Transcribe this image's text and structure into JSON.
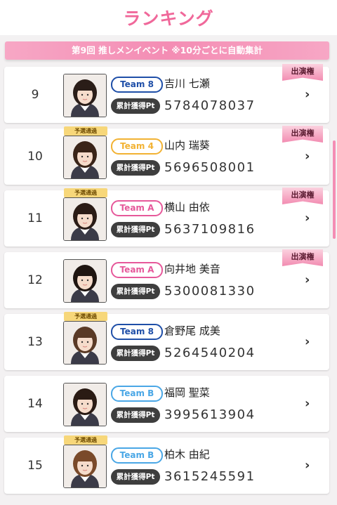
{
  "page": {
    "title": "ランキング"
  },
  "banner": {
    "text": "第9回 推しメンイベント ※10分ごとに自動集計"
  },
  "labels": {
    "points_label": "累計獲得Pt",
    "badge": "予選通過",
    "ribbon": "出演権",
    "chevron": "›"
  },
  "colors": {
    "accent": "#f0689a",
    "team8": "#1f4fa8",
    "team4": "#f2b233",
    "teamA": "#e6589a",
    "teamB": "#4aa7e6"
  },
  "rankings": [
    {
      "rank": "9",
      "team": "Team 8",
      "name": "吉川 七瀬",
      "points": "5784078037",
      "badge": false,
      "ribbon": true
    },
    {
      "rank": "10",
      "team": "Team 4",
      "name": "山内 瑞葵",
      "points": "5696508001",
      "badge": true,
      "ribbon": true
    },
    {
      "rank": "11",
      "team": "Team A",
      "name": "横山 由依",
      "points": "5637109816",
      "badge": true,
      "ribbon": true
    },
    {
      "rank": "12",
      "team": "Team A",
      "name": "向井地 美音",
      "points": "5300081330",
      "badge": false,
      "ribbon": true
    },
    {
      "rank": "13",
      "team": "Team 8",
      "name": "倉野尾 成美",
      "points": "5264540204",
      "badge": true,
      "ribbon": false
    },
    {
      "rank": "14",
      "team": "Team B",
      "name": "福岡 聖菜",
      "points": "3995613904",
      "badge": false,
      "ribbon": false
    },
    {
      "rank": "15",
      "team": "Team B",
      "name": "柏木 由紀",
      "points": "3615245591",
      "badge": true,
      "ribbon": false
    }
  ]
}
